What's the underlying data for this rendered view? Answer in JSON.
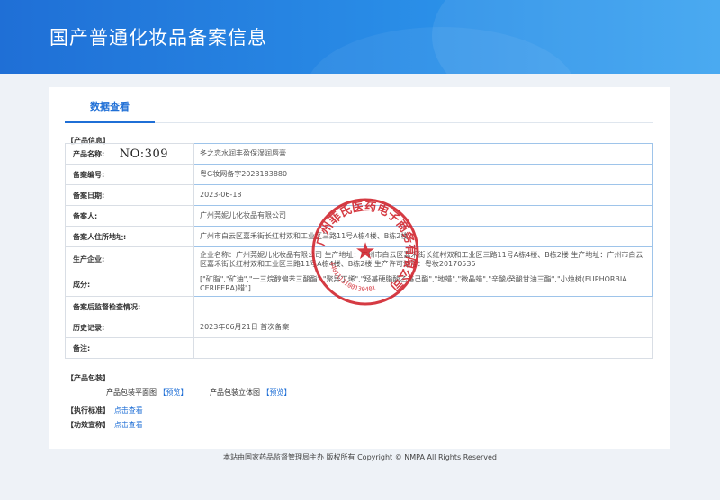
{
  "header": {
    "title": "国产普通化妆品备案信息"
  },
  "tabs": [
    {
      "label": "数据查看"
    }
  ],
  "product_section": {
    "label": "【产品信息】"
  },
  "annotation": {
    "handwritten": "NO:309"
  },
  "rows": [
    {
      "label": "产品名称:",
      "value": "冬之恋水润丰盈保湿润唇膏"
    },
    {
      "label": "备案编号:",
      "value": "粤G妆网备字2023183880"
    },
    {
      "label": "备案日期:",
      "value": "2023-06-18"
    },
    {
      "label": "备案人:",
      "value": "广州莞妮儿化妆品有限公司"
    },
    {
      "label": "备案人住所地址:",
      "value": "广州市白云区嘉禾街长红村双和工业区三路11号A栋4楼、B栋2楼"
    },
    {
      "label": "生产企业:",
      "value": "企业名称：广州莞妮儿化妆品有限公司 生产地址：广州市白云区嘉禾街长红村双和工业区三路11号A栋4楼、B栋2楼 生产地址：广州市白云区嘉禾街长红村双和工业区三路11号A栋4楼、B栋2楼 生产许可证号：粤妆20170535"
    },
    {
      "label": "成分:",
      "value": "[\"矿脂\",\"矿油\",\"十三烷醇偏苯三酸酯\",\"聚异丁烯\",\"羟基硬脂酸乙基己酯\",\"地蜡\",\"微晶蜡\",\"辛酸/癸酸甘油三酯\",\"小烛树(EUPHORBIA CERIFERA)蜡\"]"
    },
    {
      "label": "备案后监督检查情况:",
      "value": ""
    },
    {
      "label": "历史记录:",
      "value": "2023年06月21日 首次备案"
    },
    {
      "label": "备注:",
      "value": ""
    }
  ],
  "packaging": {
    "label": "【产品包装】",
    "flat_label": "产品包装平面图",
    "flat_link": "【预览】",
    "solid_label": "产品包装立体图",
    "solid_link": "【预览】"
  },
  "standard": {
    "label": "【执行标准】",
    "link": "点击查看"
  },
  "efficacy": {
    "label": "【功效宣称】",
    "link": "点击查看"
  },
  "stamp": {
    "text": "广州菲氏医药电子商务有限公司",
    "number": "4401113100130401"
  },
  "footer": {
    "text": "本站由国家药品监督管理局主办 版权所有 Copyright © NMPA All Rights Reserved"
  },
  "colors": {
    "banner": "#1f6fd6",
    "accent": "#1f6fd6",
    "stamp": "#d0202a"
  }
}
